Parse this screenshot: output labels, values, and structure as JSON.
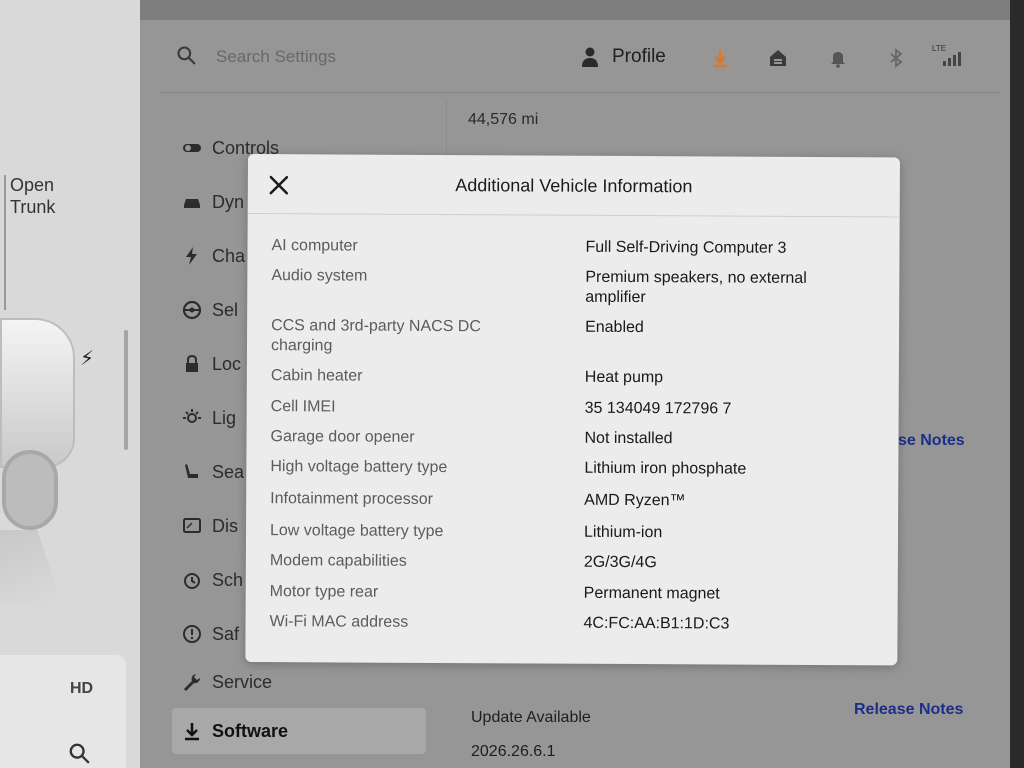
{
  "car_panel": {
    "open_trunk_line1": "Open",
    "open_trunk_line2": "Trunk"
  },
  "topbar": {
    "search_placeholder": "Search Settings",
    "profile_label": "Profile",
    "signal_label": "LTE"
  },
  "menu": {
    "items": [
      {
        "label": "Controls"
      },
      {
        "label": "Dyn"
      },
      {
        "label": "Cha"
      },
      {
        "label": "Sel"
      },
      {
        "label": "Loc"
      },
      {
        "label": "Lig"
      },
      {
        "label": "Sea"
      },
      {
        "label": "Dis"
      },
      {
        "label": "Sch"
      },
      {
        "label": "Saf"
      },
      {
        "label": "Service"
      },
      {
        "label": "Software"
      }
    ]
  },
  "main": {
    "odometer": "44,576 mi",
    "release_notes_partial": "se Notes",
    "update_available": "Update Available",
    "release_notes": "Release Notes",
    "version": "2026.26.6.1"
  },
  "modal": {
    "title": "Additional Vehicle Information",
    "rows": [
      {
        "label": "AI computer",
        "value": "Full Self-Driving Computer 3"
      },
      {
        "label": "Audio system",
        "value": "Premium speakers, no external amplifier"
      },
      {
        "label": "CCS and 3rd-party NACS DC charging",
        "value": "Enabled"
      },
      {
        "label": "Cabin heater",
        "value": "Heat pump"
      },
      {
        "label": "Cell IMEI",
        "value": "35 134049 172796 7"
      },
      {
        "label": "Garage door opener",
        "value": "Not installed"
      },
      {
        "label": "High voltage battery type",
        "value": "Lithium iron phosphate"
      },
      {
        "label": "Infotainment processor",
        "value": "AMD Ryzen™"
      },
      {
        "label": "Low voltage battery type",
        "value": "Lithium-ion"
      },
      {
        "label": "Modem capabilities",
        "value": "2G/3G/4G"
      },
      {
        "label": "Motor type rear",
        "value": "Permanent magnet"
      },
      {
        "label": "Wi-Fi MAC address",
        "value": "4C:FC:AA:B1:1D:C3"
      }
    ]
  },
  "colors": {
    "accent_download": "#e0761f",
    "link_blue": "#1b2f8a"
  }
}
